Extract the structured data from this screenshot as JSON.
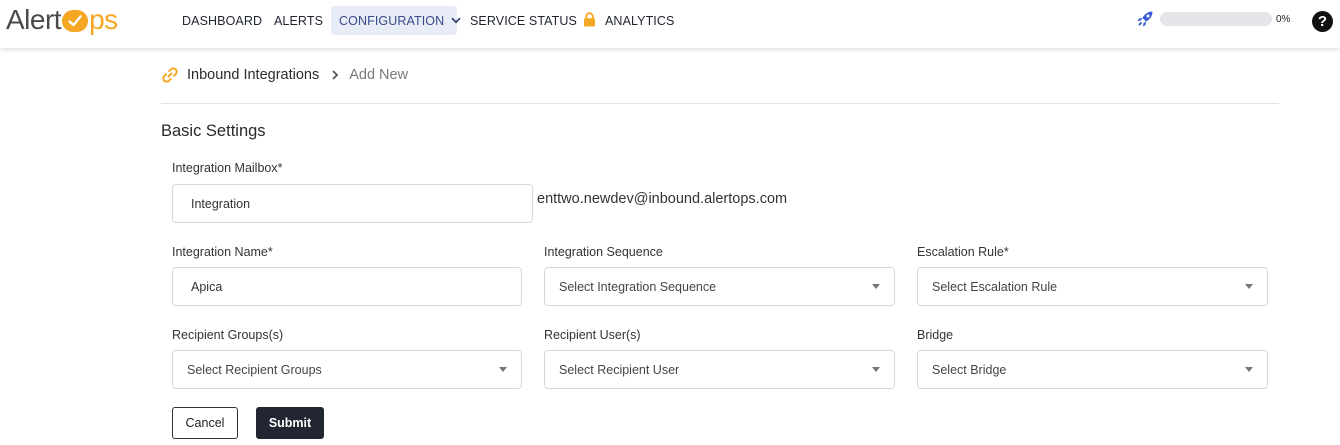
{
  "app": {
    "logo_text_left": "Alert",
    "logo_text_right": "ps"
  },
  "nav": {
    "items": [
      {
        "label": "DASHBOARD"
      },
      {
        "label": "ALERTS"
      },
      {
        "label": "CONFIGURATION"
      },
      {
        "label": "SERVICE STATUS"
      },
      {
        "label": "ANALYTICS"
      }
    ],
    "active": "CONFIGURATION"
  },
  "progress": {
    "label": "0%",
    "value": 0
  },
  "breadcrumb": {
    "parent": "Inbound Integrations",
    "current": "Add New"
  },
  "form": {
    "section_title": "Basic Settings",
    "mailbox": {
      "label": "Integration Mailbox*",
      "value": "Integration",
      "suffix": "enttwo.newdev@inbound.alertops.com"
    },
    "name": {
      "label": "Integration Name*",
      "value": "Apica"
    },
    "sequence": {
      "label": "Integration Sequence",
      "placeholder": "Select Integration Sequence"
    },
    "escalation": {
      "label": "Escalation Rule*",
      "placeholder": "Select Escalation Rule"
    },
    "groups": {
      "label": "Recipient Groups(s)",
      "placeholder": "Select Recipient Groups"
    },
    "users": {
      "label": "Recipient User(s)",
      "placeholder": "Select Recipient User"
    },
    "bridge": {
      "label": "Bridge",
      "placeholder": "Select Bridge"
    },
    "cancel_label": "Cancel",
    "submit_label": "Submit"
  },
  "colors": {
    "brand_orange": "#f5a623",
    "active_nav_bg": "#e8ecf6",
    "submit_bg": "#222632"
  },
  "icons": {
    "rocket": "rocket-icon",
    "lock": "lock-icon",
    "help": "help-icon",
    "link": "link-icon",
    "chevron_right": "chevron-right-icon",
    "chevron_down": "chevron-down-icon"
  }
}
